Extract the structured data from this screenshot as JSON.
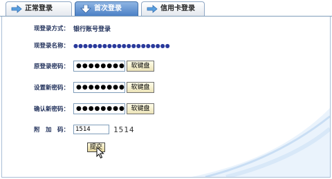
{
  "tabs": [
    {
      "label": "正常登录"
    },
    {
      "label": "首次登录"
    },
    {
      "label": "信用卡登录"
    }
  ],
  "form": {
    "login_method_label": "现登录方式：",
    "login_method_value": "银行账号登录",
    "login_name_label": "现登录名称：",
    "login_name_value": "●●●●●●●●●●●●●●●●●●●●",
    "old_password_label": "原登录密码：",
    "old_password_value": "●●●●●●●●",
    "new_password_label": "设置新密码：",
    "new_password_value": "●●●●●●●●",
    "confirm_password_label": "确认新密码：",
    "confirm_password_value": "●●●●●●●●",
    "extra_code_label": "附　加　码：",
    "extra_code_value": "1514",
    "captcha_text": "1514",
    "soft_keyboard_label": "软键盘",
    "submit_label": "提交"
  },
  "colors": {
    "active_tab": "#4b80c6",
    "label_text": "#1f2f5a",
    "button_bg": "#ece3b8"
  }
}
